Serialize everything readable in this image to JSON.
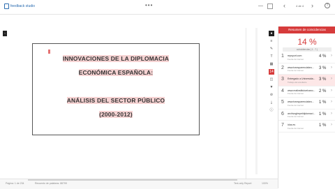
{
  "app": {
    "name": "feedback studio"
  },
  "toolbar": {
    "menu_glyph": "•••",
    "minimize_glyph": "—",
    "prev_glyph": "‹",
    "page_label": "4 de 4",
    "next_glyph": "›",
    "help_glyph": "?"
  },
  "left_tab": {
    "glyph": "‹"
  },
  "document": {
    "lines": [
      "INNOVACIONES DE LA DIPLOMACIA",
      "ECONÓMICA ESPAÑOLA:",
      "ANÁLISIS DEL SECTOR PÚBLICO",
      "(2000-2012)"
    ]
  },
  "tools": [
    {
      "glyph": "●",
      "style": "dark",
      "icon": "layers-icon"
    },
    {
      "glyph": "≡",
      "style": "plain",
      "icon": "filter-icon"
    },
    {
      "glyph": "✎",
      "style": "plain",
      "icon": "comment-icon"
    },
    {
      "glyph": "T",
      "style": "plain",
      "icon": "text-icon"
    },
    {
      "glyph": "▦",
      "style": "plain",
      "icon": "grid-icon"
    },
    {
      "glyph": "14",
      "style": "red",
      "icon": "similarity-score-icon"
    },
    {
      "glyph": "◫",
      "style": "plain",
      "icon": "view-icon"
    },
    {
      "glyph": "▼",
      "style": "plain",
      "icon": "funnel-icon"
    },
    {
      "glyph": "⊘",
      "style": "plain",
      "icon": "exclude-icon"
    },
    {
      "glyph": "⤓",
      "style": "plain",
      "icon": "download-icon"
    },
    {
      "glyph": "ⓘ",
      "style": "plain",
      "icon": "info-icon"
    }
  ],
  "panel": {
    "header": "Resumen de coincidencias",
    "overall": "14 %",
    "sources_header": "coincidencias ( 1 - 7 )",
    "rows": [
      {
        "num": "1",
        "source": "repsport.com",
        "type": "Fuente de Internet",
        "pct": "4 %",
        "selected": false
      },
      {
        "num": "2",
        "source": "www.transparenciabra...",
        "type": "Fuente de Internet",
        "pct": "3 %",
        "selected": false
      },
      {
        "num": "3",
        "source": "Entregado a Universida...",
        "type": "Trabajo del estudiante",
        "pct": "3 %",
        "selected": true
      },
      {
        "num": "4",
        "source": "www.realinstitutoelcano...",
        "type": "Fuente de Internet",
        "pct": "2 %",
        "selected": false
      },
      {
        "num": "5",
        "source": "www.transparenciabra...",
        "type": "Fuente de Internet",
        "pct": "1 %",
        "selected": false
      },
      {
        "num": "6",
        "source": "archivoghepeldiplomaci...",
        "type": "Fuente de Internet",
        "pct": "1 %",
        "selected": false
      },
      {
        "num": "7",
        "source": "idus.es",
        "type": "Fuente de Internet",
        "pct": "1 %",
        "selected": false
      }
    ]
  },
  "status": {
    "left": "Página: 1 de 234",
    "words": "Recuento de palabras: 88799",
    "right": "Text-only Report",
    "zoom": "100%"
  }
}
